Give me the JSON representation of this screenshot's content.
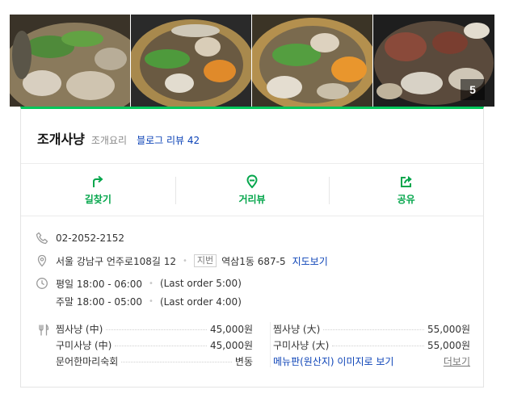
{
  "photos": {
    "items": [
      {
        "name": "photo-1"
      },
      {
        "name": "photo-2"
      },
      {
        "name": "photo-3"
      },
      {
        "name": "photo-4"
      }
    ],
    "count": "5"
  },
  "place": {
    "name": "조개사냥",
    "category": "조개요리",
    "review_label": "블로그 리뷰 42"
  },
  "actions": [
    {
      "label": "길찾기",
      "icon": "directions-icon"
    },
    {
      "label": "거리뷰",
      "icon": "street-view-icon"
    },
    {
      "label": "공유",
      "icon": "share-icon"
    }
  ],
  "info": {
    "phone": "02-2052-2152",
    "address": "서울 강남구 언주로108길 12",
    "jibun_tag": "지번",
    "jibun_address": "역삼1동 687-5",
    "map_link": "지도보기",
    "hours": [
      {
        "day": "평일 18:00 - 06:00",
        "last_order": "(Last order 5:00)"
      },
      {
        "day": "주말 18:00 - 05:00",
        "last_order": "(Last order 4:00)"
      }
    ]
  },
  "menu": {
    "left": [
      {
        "name": "찜사냥 (中)",
        "price": "45,000원"
      },
      {
        "name": "구미사냥 (中)",
        "price": "45,000원"
      },
      {
        "name": "문어한마리숙회",
        "price": "변동"
      }
    ],
    "right": [
      {
        "name": "찜사냥 (大)",
        "price": "55,000원"
      },
      {
        "name": "구미사냥 (大)",
        "price": "55,000원"
      }
    ],
    "board_link": "메뉴판(원산지) 이미지로 보기",
    "more_link": "더보기"
  },
  "colors": {
    "accent": "#03c75a",
    "action_text": "#05a64c",
    "link": "#0c43b7"
  }
}
